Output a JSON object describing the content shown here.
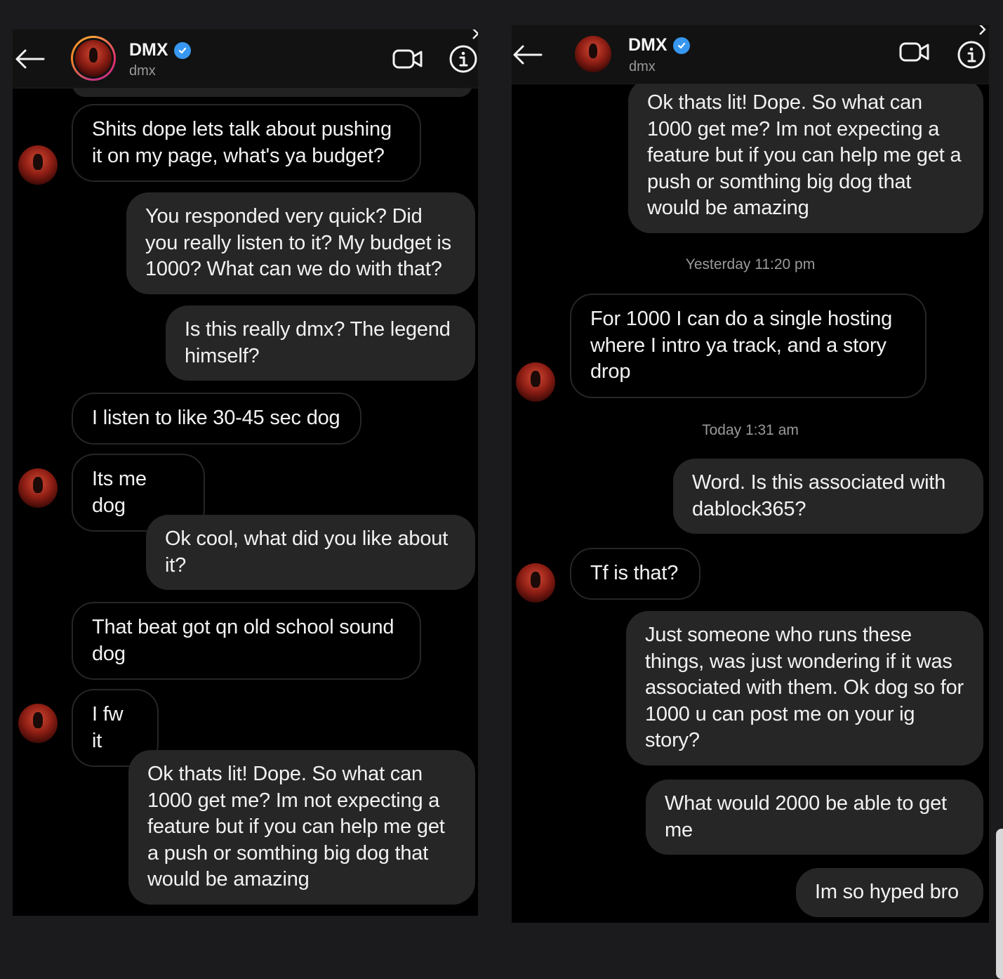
{
  "left": {
    "contact_name": "DMX",
    "contact_handle": "dmx",
    "messages": [
      {
        "dir": "in",
        "text": "Shits dope lets talk about pushing it on my page, what's ya budget?"
      },
      {
        "dir": "out",
        "text": "You responded very quick? Did you really listen to it? My budget is 1000? What can we do with that?"
      },
      {
        "dir": "out",
        "text": "Is this really dmx? The legend himself?"
      },
      {
        "dir": "in",
        "text": "I listen to like 30-45 sec dog"
      },
      {
        "dir": "in",
        "text": "Its me dog"
      },
      {
        "dir": "out",
        "text": "Ok cool, what did you like about it?"
      },
      {
        "dir": "in",
        "text": "That beat got qn old school sound dog"
      },
      {
        "dir": "in",
        "text": "I fw it"
      },
      {
        "dir": "out",
        "text": "Ok thats lit! Dope. So what can 1000 get me? Im not expecting a feature but if you can help me get a push or somthing big dog that would be amazing"
      }
    ]
  },
  "right": {
    "contact_name": "DMX",
    "contact_handle": "dmx",
    "messages": [
      {
        "dir": "out",
        "text": "Ok thats lit! Dope. So what can 1000 get me? Im not expecting a feature but if you can help me get a push or somthing big dog that would be amazing"
      },
      {
        "dir": "in",
        "text": "For 1000 I can do a single hosting where I intro ya track, and a story drop"
      },
      {
        "dir": "out",
        "text": "Word. Is this associated with dablock365?"
      },
      {
        "dir": "in",
        "text": "Tf is that?"
      },
      {
        "dir": "out",
        "text": "Just someone who runs these things, was just wondering if it was associated with them. Ok dog so for 1000 u can post me on your ig story?"
      },
      {
        "dir": "out",
        "text": "What would 2000 be able to get me"
      },
      {
        "dir": "out",
        "text": "Im so hyped bro"
      }
    ],
    "timestamps": [
      "Yesterday 11:20 pm",
      "Today 1:31 am"
    ]
  },
  "icons": {
    "back": "arrow-left-icon",
    "verified": "verified-badge-icon",
    "video": "video-camera-icon",
    "info": "info-icon"
  },
  "colors": {
    "background": "#000000",
    "outgoing_bubble": "#262626",
    "incoming_border": "#262626",
    "verified": "#3897f0",
    "muted_text": "#9a9a9a"
  }
}
